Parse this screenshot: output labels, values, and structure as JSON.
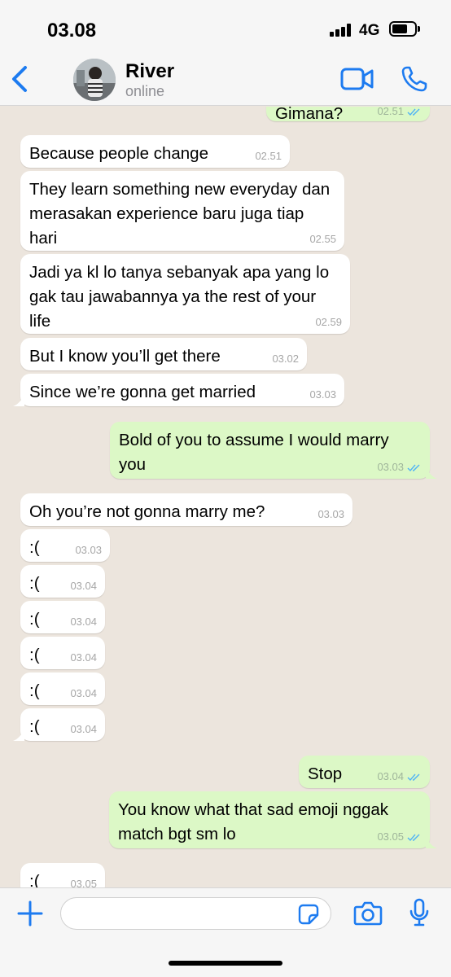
{
  "status_bar": {
    "time": "03.08",
    "network": "4G"
  },
  "header": {
    "contact_name": "River",
    "contact_status": "online"
  },
  "colors": {
    "accent": "#1d7bf0",
    "outgoing_bubble": "#dcf8c6",
    "incoming_bubble": "#ffffff",
    "chat_background": "#ece5dd",
    "read_ticks": "#4fb3f5"
  },
  "icons": {
    "back": "chevron-left-icon",
    "video": "video-camera-icon",
    "call": "phone-icon",
    "attach": "plus-icon",
    "sticker": "sticker-icon",
    "camera": "camera-icon",
    "mic": "microphone-icon"
  },
  "messages": [
    {
      "dir": "out",
      "text": "Gimana?",
      "time": "02.51",
      "read": true
    },
    {
      "dir": "in",
      "text": "Because people change",
      "time": "02.51"
    },
    {
      "dir": "in",
      "text": "They learn something new everyday dan merasakan experience baru juga tiap hari",
      "time": "02.55"
    },
    {
      "dir": "in",
      "text": "Jadi ya kl lo tanya sebanyak apa yang lo gak tau jawabannya ya the rest of your life",
      "time": "02.59"
    },
    {
      "dir": "in",
      "text": "But I know you’ll get there",
      "time": "03.02"
    },
    {
      "dir": "in",
      "text": "Since we’re gonna get married",
      "time": "03.03"
    },
    {
      "dir": "out",
      "text": "Bold of you to assume I would marry you",
      "time": "03.03",
      "read": true
    },
    {
      "dir": "in",
      "text": "Oh you’re not gonna marry me?",
      "time": "03.03"
    },
    {
      "dir": "in",
      "text": ":(",
      "time": "03.03"
    },
    {
      "dir": "in",
      "text": ":(",
      "time": "03.04"
    },
    {
      "dir": "in",
      "text": ":(",
      "time": "03.04"
    },
    {
      "dir": "in",
      "text": ":(",
      "time": "03.04"
    },
    {
      "dir": "in",
      "text": ":(",
      "time": "03.04"
    },
    {
      "dir": "in",
      "text": ":(",
      "time": "03.04"
    },
    {
      "dir": "out",
      "text": "Stop",
      "time": "03.04",
      "read": true
    },
    {
      "dir": "out",
      "text": "You know what that sad emoji nggak match bgt sm lo",
      "time": "03.05",
      "read": true
    },
    {
      "dir": "in",
      "text": ":(",
      "time": "03.05"
    }
  ],
  "composer": {
    "placeholder": ""
  }
}
